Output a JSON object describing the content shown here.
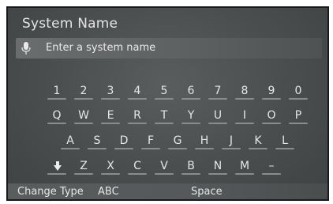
{
  "header": {
    "title": "System Name"
  },
  "input": {
    "placeholder": "Enter a system name"
  },
  "keyboard": {
    "row1": [
      "1",
      "2",
      "3",
      "4",
      "5",
      "6",
      "7",
      "8",
      "9",
      "0"
    ],
    "row2": [
      "Q",
      "W",
      "E",
      "R",
      "T",
      "Y",
      "U",
      "I",
      "O",
      "P"
    ],
    "row3": [
      "A",
      "S",
      "D",
      "F",
      "G",
      "H",
      "J",
      "K",
      "L"
    ],
    "row4": [
      "Z",
      "X",
      "C",
      "V",
      "B",
      "N",
      "M",
      "–"
    ]
  },
  "bottom_bar": {
    "change_type_label": "Change Type",
    "abc_label": "ABC",
    "space_label": "Space"
  },
  "icons": {
    "mic": "microphone-icon",
    "shift": "down-arrow-icon"
  }
}
